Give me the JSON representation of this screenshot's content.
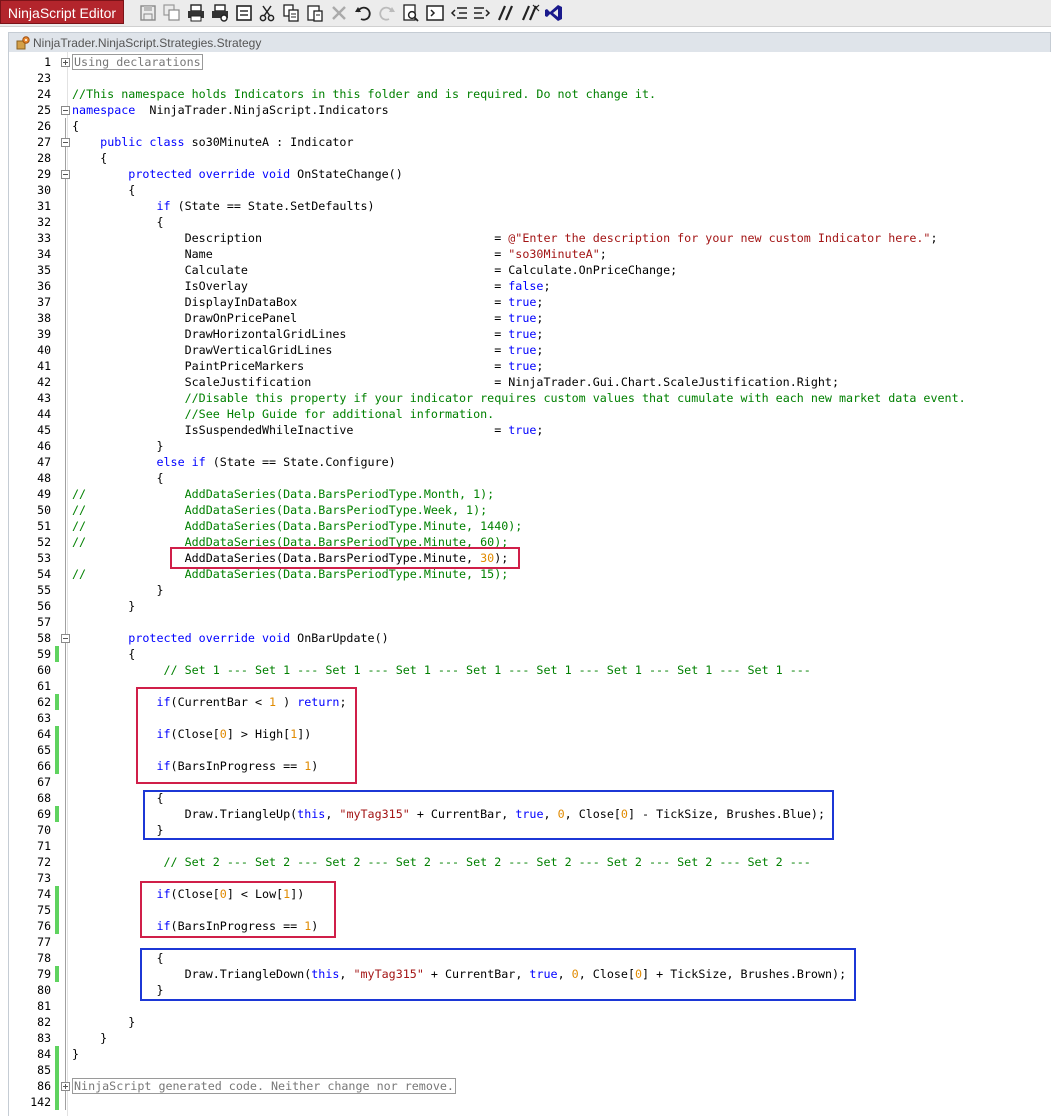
{
  "app": {
    "title": "NinjaScript Editor"
  },
  "toolbar": [
    {
      "icon": "save-icon"
    },
    {
      "icon": "save-all-icon"
    },
    {
      "icon": "print-icon"
    },
    {
      "icon": "print-preview-icon"
    },
    {
      "icon": "properties-icon"
    },
    {
      "icon": "cut-icon"
    },
    {
      "icon": "copy-icon"
    },
    {
      "icon": "paste-icon"
    },
    {
      "icon": "delete-icon"
    },
    {
      "icon": "undo-icon"
    },
    {
      "icon": "redo-icon"
    },
    {
      "icon": "find-icon"
    },
    {
      "icon": "compile-icon"
    },
    {
      "icon": "outdent-icon"
    },
    {
      "icon": "indent-icon"
    },
    {
      "icon": "comment-icon"
    },
    {
      "icon": "uncomment-icon"
    },
    {
      "icon": "visual-studio-icon"
    }
  ],
  "tab": {
    "title": "NinjaTrader.NinjaScript.Strategies.Strategy"
  },
  "editor": {
    "lines": [
      {
        "n": "1",
        "fold": "plus",
        "collapsed": "Using declarations",
        "indent": ""
      },
      {
        "n": "23",
        "t": []
      },
      {
        "n": "24",
        "t": [
          [
            "cm",
            "//This namespace holds Indicators in this folder and is required. Do not change it."
          ]
        ]
      },
      {
        "n": "25",
        "fold": "minus",
        "t": [
          [
            "kw",
            "namespace"
          ],
          [
            "",
            "  NinjaTrader.NinjaScript.Indicators"
          ]
        ]
      },
      {
        "n": "26",
        "t": [
          [
            "",
            "{"
          ]
        ]
      },
      {
        "n": "27",
        "fold": "minus",
        "t": [
          [
            "",
            "    "
          ],
          [
            "kw",
            "public class"
          ],
          [
            "",
            " so30MinuteA : Indicator"
          ]
        ]
      },
      {
        "n": "28",
        "t": [
          [
            "",
            "    {"
          ]
        ]
      },
      {
        "n": "29",
        "fold": "minus",
        "t": [
          [
            "",
            "        "
          ],
          [
            "kw",
            "protected override void"
          ],
          [
            "",
            " OnStateChange()"
          ]
        ]
      },
      {
        "n": "30",
        "t": [
          [
            "",
            "        {"
          ]
        ]
      },
      {
        "n": "31",
        "t": [
          [
            "",
            "            "
          ],
          [
            "kw",
            "if"
          ],
          [
            "",
            " (State == State.SetDefaults)"
          ]
        ]
      },
      {
        "n": "32",
        "t": [
          [
            "",
            "            {"
          ]
        ]
      },
      {
        "n": "33",
        "t": [
          [
            "",
            "                Description                                 = "
          ],
          [
            "st",
            "@\"Enter the description for your new custom Indicator here.\""
          ],
          [
            "",
            ";"
          ]
        ]
      },
      {
        "n": "34",
        "t": [
          [
            "",
            "                Name                                        = "
          ],
          [
            "st",
            "\"so30MinuteA\""
          ],
          [
            "",
            ";"
          ]
        ]
      },
      {
        "n": "35",
        "t": [
          [
            "",
            "                Calculate                                   = Calculate.OnPriceChange;"
          ]
        ]
      },
      {
        "n": "36",
        "t": [
          [
            "",
            "                IsOverlay                                   = "
          ],
          [
            "kw",
            "false"
          ],
          [
            "",
            ";"
          ]
        ]
      },
      {
        "n": "37",
        "t": [
          [
            "",
            "                DisplayInDataBox                            = "
          ],
          [
            "kw",
            "true"
          ],
          [
            "",
            ";"
          ]
        ]
      },
      {
        "n": "38",
        "t": [
          [
            "",
            "                DrawOnPricePanel                            = "
          ],
          [
            "kw",
            "true"
          ],
          [
            "",
            ";"
          ]
        ]
      },
      {
        "n": "39",
        "t": [
          [
            "",
            "                DrawHorizontalGridLines                     = "
          ],
          [
            "kw",
            "true"
          ],
          [
            "",
            ";"
          ]
        ]
      },
      {
        "n": "40",
        "t": [
          [
            "",
            "                DrawVerticalGridLines                       = "
          ],
          [
            "kw",
            "true"
          ],
          [
            "",
            ";"
          ]
        ]
      },
      {
        "n": "41",
        "t": [
          [
            "",
            "                PaintPriceMarkers                           = "
          ],
          [
            "kw",
            "true"
          ],
          [
            "",
            ";"
          ]
        ]
      },
      {
        "n": "42",
        "t": [
          [
            "",
            "                ScaleJustification                          = NinjaTrader.Gui.Chart.ScaleJustification.Right;"
          ]
        ]
      },
      {
        "n": "43",
        "t": [
          [
            "",
            "                "
          ],
          [
            "cm",
            "//Disable this property if your indicator requires custom values that cumulate with each new market data event."
          ]
        ]
      },
      {
        "n": "44",
        "t": [
          [
            "",
            "                "
          ],
          [
            "cm",
            "//See Help Guide for additional information."
          ]
        ]
      },
      {
        "n": "45",
        "t": [
          [
            "",
            "                IsSuspendedWhileInactive                    = "
          ],
          [
            "kw",
            "true"
          ],
          [
            "",
            ";"
          ]
        ]
      },
      {
        "n": "46",
        "t": [
          [
            "",
            "            }"
          ]
        ]
      },
      {
        "n": "47",
        "t": [
          [
            "",
            "            "
          ],
          [
            "kw",
            "else if"
          ],
          [
            "",
            " (State == State.Configure)"
          ]
        ]
      },
      {
        "n": "48",
        "t": [
          [
            "",
            "            {"
          ]
        ]
      },
      {
        "n": "49",
        "t": [
          [
            "cm",
            "//              AddDataSeries(Data.BarsPeriodType.Month, 1);"
          ]
        ]
      },
      {
        "n": "50",
        "t": [
          [
            "cm",
            "//              AddDataSeries(Data.BarsPeriodType.Week, 1);"
          ]
        ]
      },
      {
        "n": "51",
        "t": [
          [
            "cm",
            "//              AddDataSeries(Data.BarsPeriodType.Minute, 1440);"
          ]
        ]
      },
      {
        "n": "52",
        "t": [
          [
            "cm",
            "//              AddDataSeries(Data.BarsPeriodType.Minute, 60);"
          ]
        ]
      },
      {
        "n": "53",
        "t": [
          [
            "",
            "                AddDataSeries(Data.BarsPeriodType.Minute, "
          ],
          [
            "nm",
            "30"
          ],
          [
            "",
            ");"
          ]
        ]
      },
      {
        "n": "54",
        "t": [
          [
            "cm",
            "//              AddDataSeries(Data.BarsPeriodType.Minute, 15);"
          ]
        ]
      },
      {
        "n": "55",
        "t": [
          [
            "",
            "            }"
          ]
        ]
      },
      {
        "n": "56",
        "t": [
          [
            "",
            "        }"
          ]
        ]
      },
      {
        "n": "57",
        "t": []
      },
      {
        "n": "58",
        "fold": "minus",
        "t": [
          [
            "",
            "        "
          ],
          [
            "kw",
            "protected override void"
          ],
          [
            "",
            " OnBarUpdate()"
          ]
        ]
      },
      {
        "n": "59",
        "chg": true,
        "t": [
          [
            "",
            "        {"
          ]
        ]
      },
      {
        "n": "60",
        "t": [
          [
            "",
            "             "
          ],
          [
            "cm",
            "// Set 1 --- Set 1 --- Set 1 --- Set 1 --- Set 1 --- Set 1 --- Set 1 --- Set 1 --- Set 1 ---"
          ]
        ]
      },
      {
        "n": "61",
        "t": []
      },
      {
        "n": "62",
        "chg": true,
        "t": [
          [
            "",
            "            "
          ],
          [
            "kw",
            "if"
          ],
          [
            "",
            "(CurrentBar < "
          ],
          [
            "nm",
            "1"
          ],
          [
            "",
            " ) "
          ],
          [
            "kw",
            "return"
          ],
          [
            "",
            ";"
          ]
        ]
      },
      {
        "n": "63",
        "t": []
      },
      {
        "n": "64",
        "chg": true,
        "t": [
          [
            "",
            "            "
          ],
          [
            "kw",
            "if"
          ],
          [
            "",
            "(Close["
          ],
          [
            "nm",
            "0"
          ],
          [
            "",
            "] > High["
          ],
          [
            "nm",
            "1"
          ],
          [
            "",
            "])"
          ]
        ]
      },
      {
        "n": "65",
        "chg": true,
        "t": []
      },
      {
        "n": "66",
        "chg": true,
        "t": [
          [
            "",
            "            "
          ],
          [
            "kw",
            "if"
          ],
          [
            "",
            "(BarsInProgress == "
          ],
          [
            "nm",
            "1"
          ],
          [
            "",
            ")"
          ]
        ]
      },
      {
        "n": "67",
        "t": []
      },
      {
        "n": "68",
        "t": [
          [
            "",
            "            {"
          ]
        ]
      },
      {
        "n": "69",
        "chg": true,
        "t": [
          [
            "",
            "                Draw.TriangleUp("
          ],
          [
            "kw",
            "this"
          ],
          [
            "",
            ", "
          ],
          [
            "st",
            "\"myTag315\""
          ],
          [
            "",
            " + CurrentBar, "
          ],
          [
            "kw",
            "true"
          ],
          [
            "",
            ", "
          ],
          [
            "nm",
            "0"
          ],
          [
            "",
            ", Close["
          ],
          [
            "nm",
            "0"
          ],
          [
            "",
            "] - TickSize, Brushes.Blue);"
          ]
        ]
      },
      {
        "n": "70",
        "t": [
          [
            "",
            "            }"
          ]
        ]
      },
      {
        "n": "71",
        "t": []
      },
      {
        "n": "72",
        "t": [
          [
            "",
            "             "
          ],
          [
            "cm",
            "// Set 2 --- Set 2 --- Set 2 --- Set 2 --- Set 2 --- Set 2 --- Set 2 --- Set 2 --- Set 2 ---"
          ]
        ]
      },
      {
        "n": "73",
        "t": []
      },
      {
        "n": "74",
        "chg": true,
        "t": [
          [
            "",
            "            "
          ],
          [
            "kw",
            "if"
          ],
          [
            "",
            "(Close["
          ],
          [
            "nm",
            "0"
          ],
          [
            "",
            "] < Low["
          ],
          [
            "nm",
            "1"
          ],
          [
            "",
            "])"
          ]
        ]
      },
      {
        "n": "75",
        "chg": true,
        "t": []
      },
      {
        "n": "76",
        "chg": true,
        "t": [
          [
            "",
            "            "
          ],
          [
            "kw",
            "if"
          ],
          [
            "",
            "(BarsInProgress == "
          ],
          [
            "nm",
            "1"
          ],
          [
            "",
            ")"
          ]
        ]
      },
      {
        "n": "77",
        "t": []
      },
      {
        "n": "78",
        "t": [
          [
            "",
            "            {"
          ]
        ]
      },
      {
        "n": "79",
        "chg": true,
        "t": [
          [
            "",
            "                Draw.TriangleDown("
          ],
          [
            "kw",
            "this"
          ],
          [
            "",
            ", "
          ],
          [
            "st",
            "\"myTag315\""
          ],
          [
            "",
            " + CurrentBar, "
          ],
          [
            "kw",
            "true"
          ],
          [
            "",
            ", "
          ],
          [
            "nm",
            "0"
          ],
          [
            "",
            ", Close["
          ],
          [
            "nm",
            "0"
          ],
          [
            "",
            "] + TickSize, Brushes.Brown);"
          ]
        ]
      },
      {
        "n": "80",
        "t": [
          [
            "",
            "            }"
          ]
        ]
      },
      {
        "n": "81",
        "t": []
      },
      {
        "n": "82",
        "t": [
          [
            "",
            "        }"
          ]
        ]
      },
      {
        "n": "83",
        "t": [
          [
            "",
            "    }"
          ]
        ]
      },
      {
        "n": "84",
        "chg": true,
        "t": [
          [
            "",
            "}"
          ]
        ]
      },
      {
        "n": "85",
        "chg": true,
        "t": []
      },
      {
        "n": "86",
        "chg": true,
        "fold": "plus",
        "collapsed": "NinjaScript generated code. Neither change nor remove.",
        "indent": ""
      },
      {
        "n": "142",
        "chg": true,
        "t": []
      }
    ]
  },
  "colors": {
    "titlebar_red": "#b3252c",
    "highlight_red": "#d01f49",
    "highlight_blue": "#1c37d6",
    "changed_line": "#5fd35f"
  }
}
